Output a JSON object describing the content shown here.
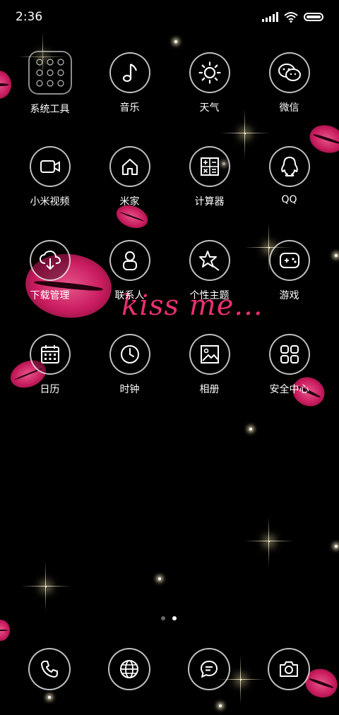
{
  "status_bar": {
    "time": "2:36"
  },
  "apps": [
    {
      "label": "系统工具",
      "icon": "folder-icon"
    },
    {
      "label": "音乐",
      "icon": "music-note-icon"
    },
    {
      "label": "天气",
      "icon": "sun-icon"
    },
    {
      "label": "微信",
      "icon": "wechat-icon"
    },
    {
      "label": "小米视频",
      "icon": "video-camera-icon"
    },
    {
      "label": "米家",
      "icon": "home-icon"
    },
    {
      "label": "计算器",
      "icon": "calculator-icon"
    },
    {
      "label": "QQ",
      "icon": "qq-penguin-icon"
    },
    {
      "label": "下载管理",
      "icon": "cloud-download-icon"
    },
    {
      "label": "联系人",
      "icon": "contact-icon"
    },
    {
      "label": "个性主题",
      "icon": "theme-star-icon"
    },
    {
      "label": "游戏",
      "icon": "gamepad-icon"
    },
    {
      "label": "日历",
      "icon": "calendar-icon"
    },
    {
      "label": "时钟",
      "icon": "clock-icon"
    },
    {
      "label": "相册",
      "icon": "gallery-icon"
    },
    {
      "label": "安全中心",
      "icon": "security-grid-icon"
    }
  ],
  "pager": {
    "pages": 2,
    "active": 2
  },
  "dock": [
    {
      "name": "phone",
      "icon": "phone-icon"
    },
    {
      "name": "browser",
      "icon": "globe-icon"
    },
    {
      "name": "messages",
      "icon": "message-icon"
    },
    {
      "name": "camera",
      "icon": "camera-icon"
    }
  ],
  "wallpaper": {
    "text": "kiss me...",
    "accent": "#e8306f"
  }
}
